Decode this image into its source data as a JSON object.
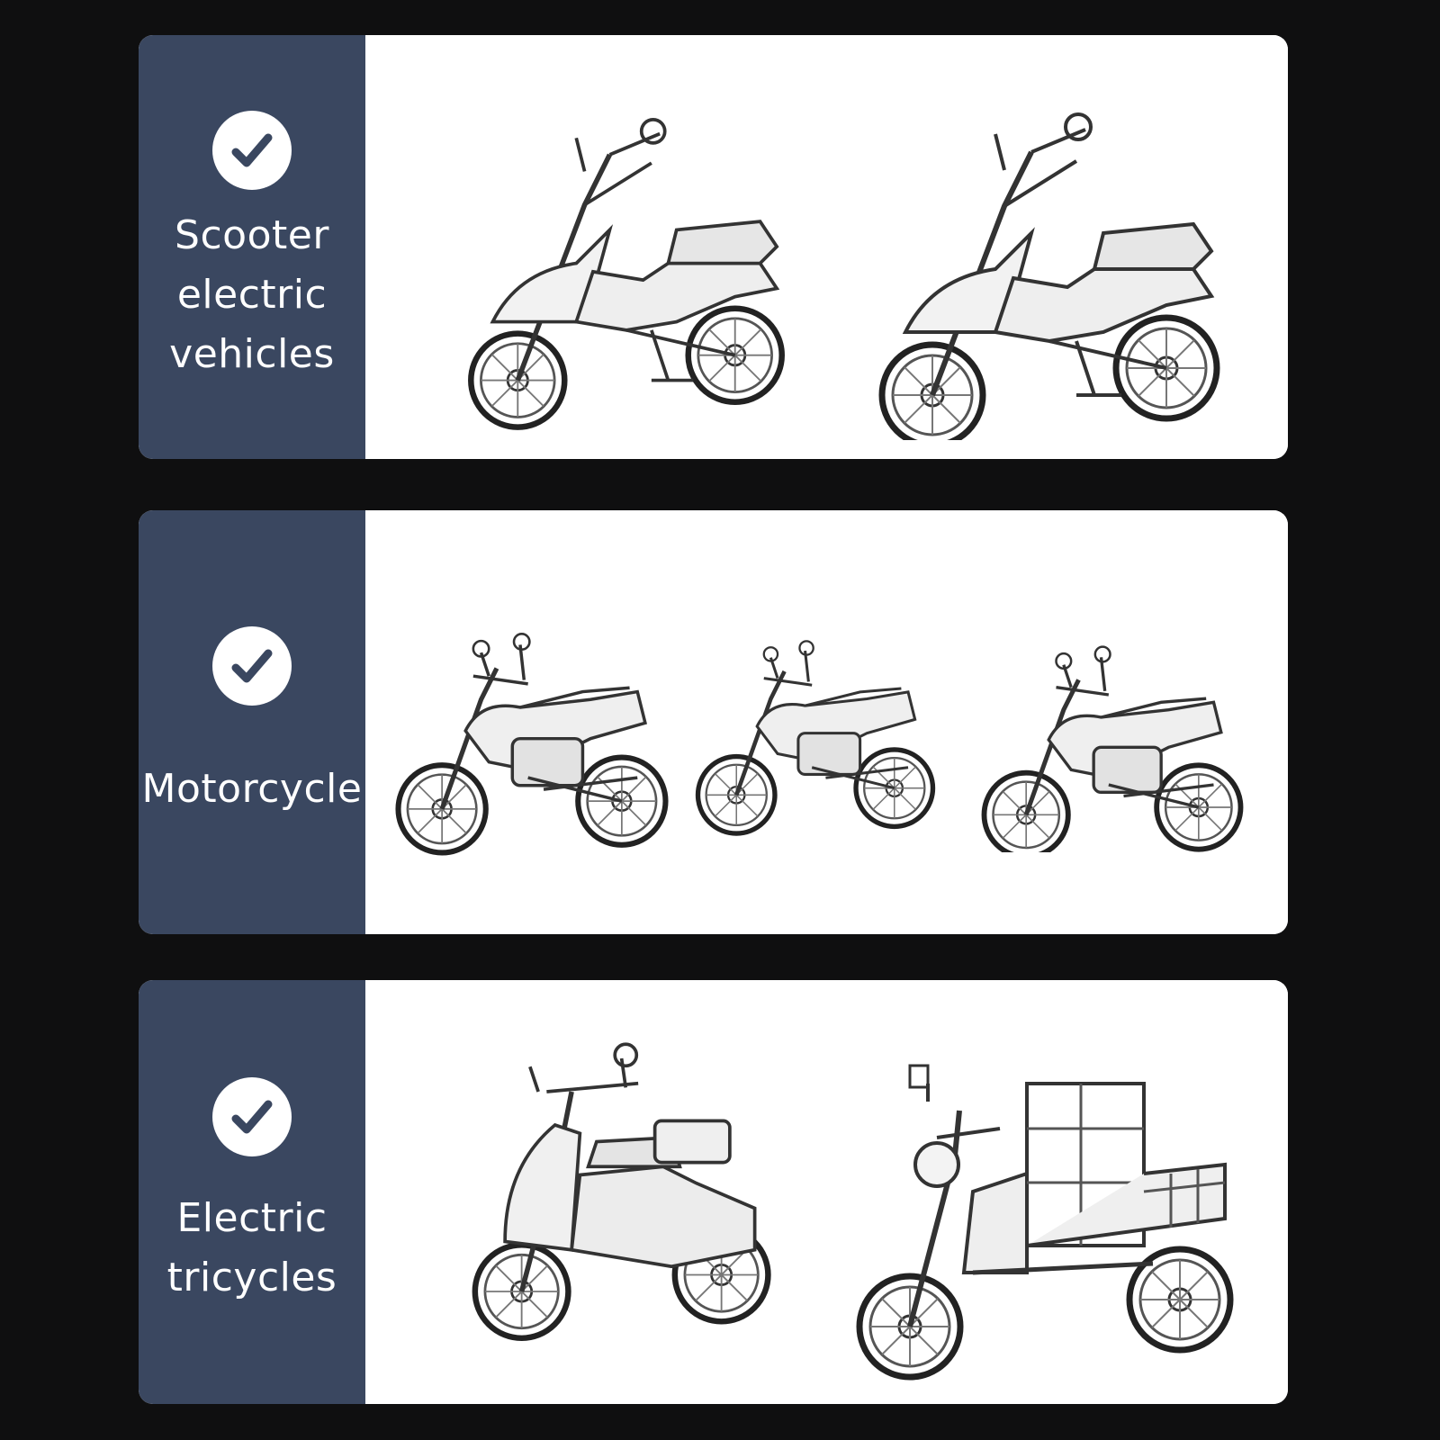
{
  "rows": [
    {
      "label": "Scooter\nelectric\nvehicles",
      "icon": "checkmark-icon",
      "vehicles": [
        "scooter-sketch",
        "scooter-sketch"
      ]
    },
    {
      "label": "Motorcycle",
      "icon": "checkmark-icon",
      "vehicles": [
        "underbone-motorcycle-sketch",
        "standard-motorcycle-sketch",
        "sport-motorcycle-sketch"
      ]
    },
    {
      "label": "Electric\ntricycles",
      "icon": "checkmark-icon",
      "vehicles": [
        "passenger-tricycle-sketch",
        "cargo-tricycle-sketch"
      ]
    }
  ],
  "colors": {
    "background": "#0f0f10",
    "sidebar": "#3a4760",
    "panel": "#ffffff",
    "check": "#3a4760",
    "sketch": "#2a2a2a"
  }
}
